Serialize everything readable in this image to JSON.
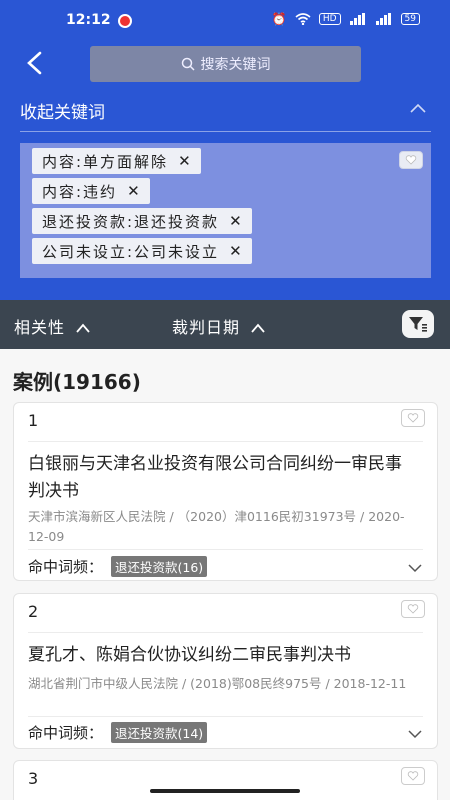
{
  "status": {
    "time": "12:12",
    "hd": "HD",
    "battery": "59"
  },
  "search": {
    "placeholder": "搜索关键词"
  },
  "filters": {
    "collapse_label": "收起关键词",
    "chips": [
      {
        "label": "内容:单方面解除",
        "close": "✕"
      },
      {
        "label": "内容:违约",
        "close": "✕"
      },
      {
        "label": "退还投资款:退还投资款",
        "close": "✕"
      },
      {
        "label": "公司未设立:公司未设立",
        "close": "✕"
      }
    ]
  },
  "sort": {
    "relevance": "相关性",
    "date": "裁判日期"
  },
  "results": {
    "count_label": "案例(19166)",
    "cases": [
      {
        "index": "1",
        "title": "白银丽与天津名业投资有限公司合同纠纷一审民事判决书",
        "meta": "天津市滨海新区人民法院 / （2020）津0116民初31973号 / 2020-12-09",
        "hit_label": "命中词频：",
        "hit_badge": "退还投资款(16)"
      },
      {
        "index": "2",
        "title": "夏孔才、陈娟合伙协议纠纷二审民事判决书",
        "meta": "湖北省荆门市中级人民法院 / (2018)鄂08民终975号 / 2018-12-11",
        "hit_label": "命中词频：",
        "hit_badge": "退还投资款(14)"
      },
      {
        "index": "3"
      }
    ]
  },
  "colors": {
    "header_blue": "#2a56d4",
    "keyword_panel": "#7d90e0",
    "sort_bar": "#3b4550"
  }
}
